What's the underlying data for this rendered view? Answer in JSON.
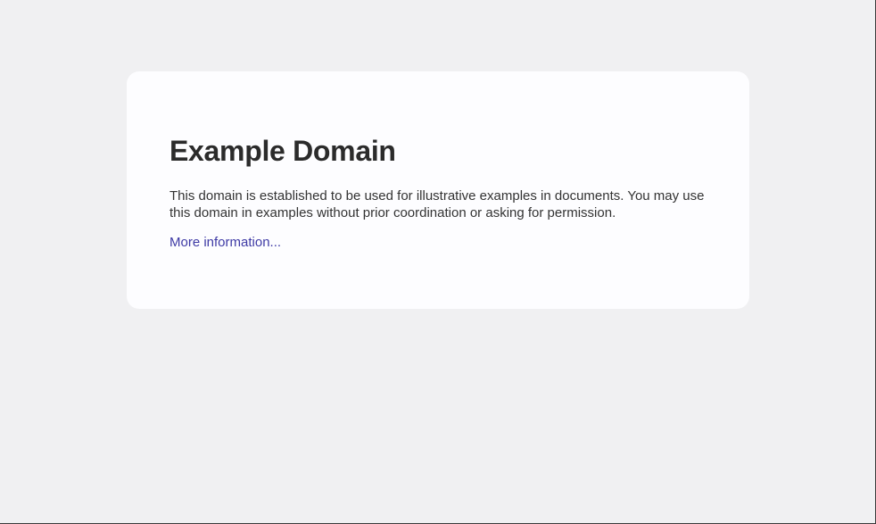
{
  "page": {
    "title": "Example Domain",
    "description": "This domain is established to be used for illustrative examples in documents. You may use this domain in examples without prior coordination or asking for permission.",
    "link_text": "More information..."
  },
  "colors": {
    "background": "#f0f0f2",
    "card": "#fdfdff",
    "heading": "#2b2b2b",
    "text": "#333333",
    "link": "#3e3aa5"
  }
}
